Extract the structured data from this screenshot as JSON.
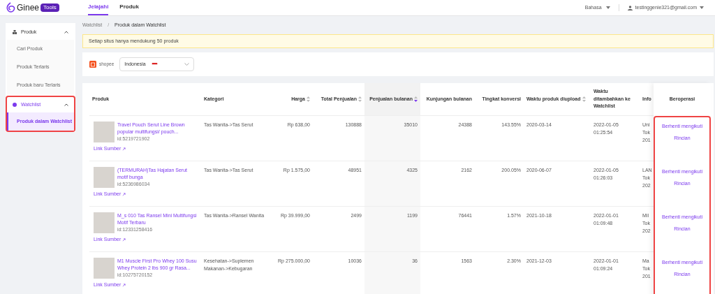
{
  "header": {
    "logo_text": "Ginee",
    "logo_badge": "Tools",
    "tabs": [
      {
        "label": "Jelajahi",
        "selected": true
      },
      {
        "label": "Produk",
        "selected": false
      }
    ],
    "language": "Bahasa",
    "user": "testinggenie321@gmail.com"
  },
  "sidebar": {
    "groups": [
      {
        "label": "Produk",
        "kind": "products",
        "expanded": true,
        "highlighted": false,
        "items": [
          {
            "label": "Cari Produk",
            "selected": false
          },
          {
            "label": "Produk Terlaris",
            "selected": false
          },
          {
            "label": "Produk baru Terlaris",
            "selected": false
          }
        ]
      },
      {
        "label": "Watchlist",
        "kind": "watchlist",
        "expanded": true,
        "highlighted": true,
        "items": [
          {
            "label": "Produk dalam Watchlist",
            "selected": true
          }
        ]
      }
    ]
  },
  "breadcrumb": {
    "items": [
      "Watchlist",
      "Produk dalam Watchlist"
    ],
    "separator": "/"
  },
  "notice": "Setiap situs hanya mendukung 50 produk",
  "filter": {
    "platform": "shopee",
    "country": "Indonesia"
  },
  "table": {
    "actions_highlighted": true,
    "columns": [
      {
        "label": "Produk"
      },
      {
        "label": "Kategori"
      },
      {
        "label": "Harga",
        "sortable": true,
        "sorted": false
      },
      {
        "label": "Total Penjualan",
        "sortable": true,
        "sorted": false
      },
      {
        "label": "Penjualan bulanan",
        "sortable": true,
        "sorted": true
      },
      {
        "label": "Kunjungan bulanan"
      },
      {
        "label": "Tingkat konversi"
      },
      {
        "label": "Waktu produk diupload",
        "sortable": true,
        "sorted": false
      },
      {
        "label": "Waktu ditambahkan ke Watchlist"
      },
      {
        "label": "Info"
      },
      {
        "label": "Beroperasi"
      }
    ],
    "rows": [
      {
        "product": {
          "name": "Travel Pouch Serut Line Brown popular multifungsi/ pouch...",
          "id": "id:5219721902",
          "link": "Link Sumber"
        },
        "category": "Tas Wanita->Tas Serut",
        "price": "Rp 638,00",
        "total_sales": "130888",
        "monthly_sales": "35010",
        "monthly_visits": "24388",
        "conversion": "143.55%",
        "uploaded": "2020-03-14",
        "added": "2022-01-05 01:25:54",
        "info": [
          "Uni",
          "Tok",
          "201"
        ],
        "actions": [
          "Berhenti mengikuti",
          "Rincian"
        ]
      },
      {
        "product": {
          "name": "(TERMURAH)Tas Hajatan Serut motif bunga",
          "id": "id:5236986034",
          "link": "Link Sumber"
        },
        "category": "Tas Wanita->Tas Serut",
        "price": "Rp 1.575,00",
        "total_sales": "48951",
        "monthly_sales": "4325",
        "monthly_visits": "2162",
        "conversion": "200.05%",
        "uploaded": "2020-06-07",
        "added": "2022-01-05 01:26:03",
        "info": [
          "LAN",
          "Tok",
          "202"
        ],
        "actions": [
          "Berhenti mengikuti",
          "Rincian"
        ]
      },
      {
        "product": {
          "name": "M_s 010 Tas Ransel Mini Multifungsi Motif Terbaru",
          "id": "id:12331258416",
          "link": "Link Sumber"
        },
        "category": "Tas Wanita->Ransel Wanita",
        "price": "Rp 39.999,00",
        "total_sales": "2499",
        "monthly_sales": "1199",
        "monthly_visits": "76441",
        "conversion": "1.57%",
        "uploaded": "2021-10-18",
        "added": "2022-01-01 01:09:48",
        "info": [
          "Mil",
          "Tok",
          "202"
        ],
        "actions": [
          "Berhenti mengikuti",
          "Rincian"
        ]
      },
      {
        "product": {
          "name": "M1 Muscle First Pro Whey 100 Susu Whey Protein 2 lbs 900 gr Rasa...",
          "id": "id:10275720152",
          "link": "Link Sumber"
        },
        "category": "Kesehatan->Suplemen Makanan->Kebugaran",
        "price": "Rp 275.000,00",
        "total_sales": "10036",
        "monthly_sales": "36",
        "monthly_visits": "1563",
        "conversion": "2.30%",
        "uploaded": "2021-12-03",
        "added": "2022-01-01 01:09:24",
        "info": [
          "Ma",
          "Tok",
          "201"
        ],
        "actions": [
          "Berhenti mengikuti",
          "Rincian"
        ]
      }
    ]
  }
}
